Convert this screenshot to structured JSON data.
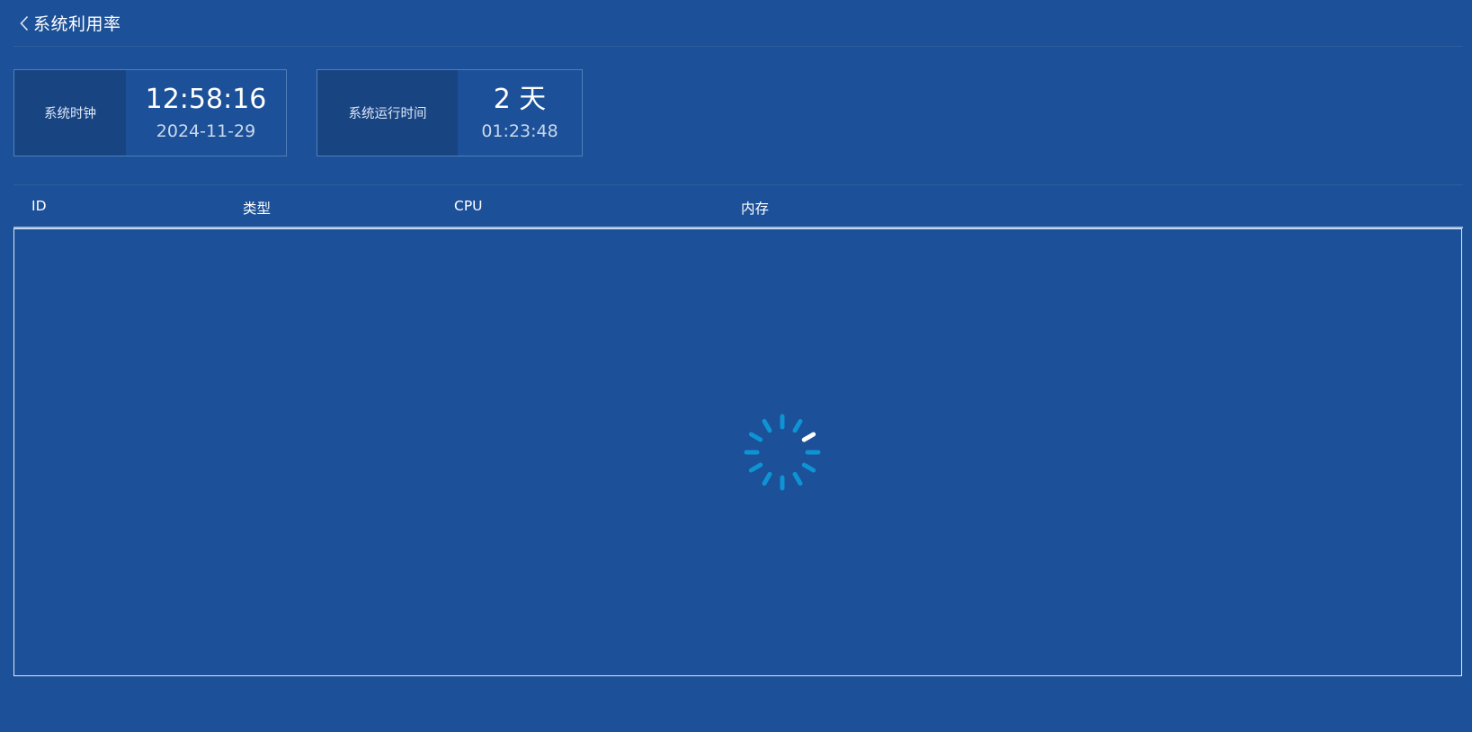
{
  "header": {
    "back_icon": "chevron-left-icon",
    "title": "系统利用率"
  },
  "cards": {
    "clock": {
      "label": "系统时钟",
      "time": "12:58:16",
      "date": "2024-11-29"
    },
    "uptime": {
      "label": "系统运行时间",
      "days": "2 天",
      "time": "01:23:48"
    }
  },
  "table": {
    "columns": [
      "ID",
      "类型",
      "CPU",
      "内存"
    ],
    "rows": []
  },
  "loading": {
    "icon": "loading-spinner-icon",
    "color": "#0e93d4",
    "highlight_color": "#ffffff"
  },
  "colors": {
    "background": "#1c5098",
    "card_label_bg": "#184582",
    "card_border": "#4f7fbb"
  }
}
